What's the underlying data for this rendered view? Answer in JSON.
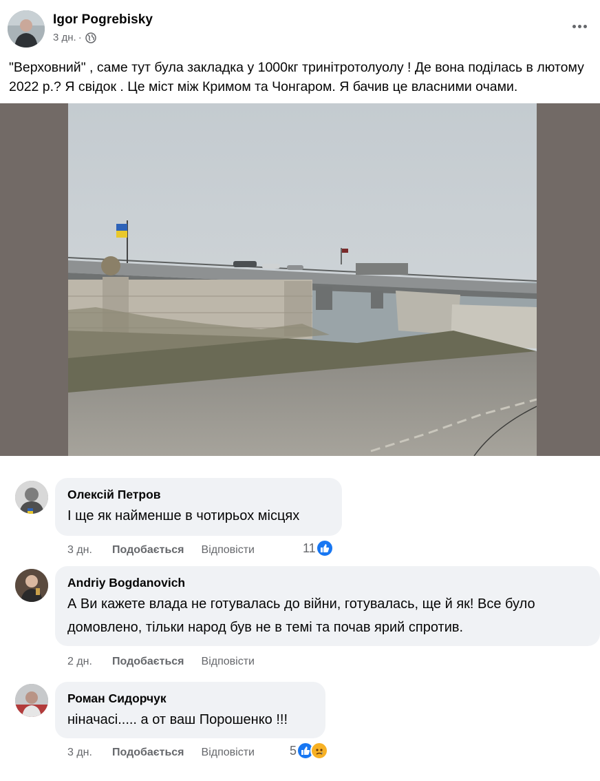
{
  "post": {
    "author": "Igor Pogrebisky",
    "time": "3 дн.",
    "separator": "·",
    "text": "\"Верховний\" , саме тут була закладка у 1000кг тринітротолуолу ! Де вона поділась  в лютому 2022 р.? Я свідок . Це міст між Кримом та Чонгаром. Я бачив це власними очами."
  },
  "icons": {
    "globe": "globe-icon",
    "more": "more-options-icon",
    "like": "like-reaction-icon",
    "sad": "sad-reaction-icon"
  },
  "colors": {
    "bubble": "#f0f2f5",
    "like_blue": "#1877f2",
    "meta_gray": "#65676b",
    "photo_frame": "#726a66"
  },
  "comments": [
    {
      "name": "Олексій Петров",
      "text": "І ще як найменше в чотирьох місцях",
      "time": "3 дн.",
      "like_label": "Подобається",
      "reply_label": "Відповісти",
      "reaction_count": "11"
    },
    {
      "name": "Andriy Bogdanovich",
      "text": "А Ви кажете влада не готувалась до війни, готувалась, ще й як! Все було домовлено, тільки народ був не в темі та почав ярий спротив.",
      "time": "2 дн.",
      "like_label": "Подобається",
      "reply_label": "Відповісти"
    },
    {
      "name": "Роман Сидорчук",
      "text": "ніначасі..... а от ваш Порошенко !!!",
      "time": "3 дн.",
      "like_label": "Подобається",
      "reply_label": "Відповісти",
      "reaction_count": "5"
    }
  ]
}
